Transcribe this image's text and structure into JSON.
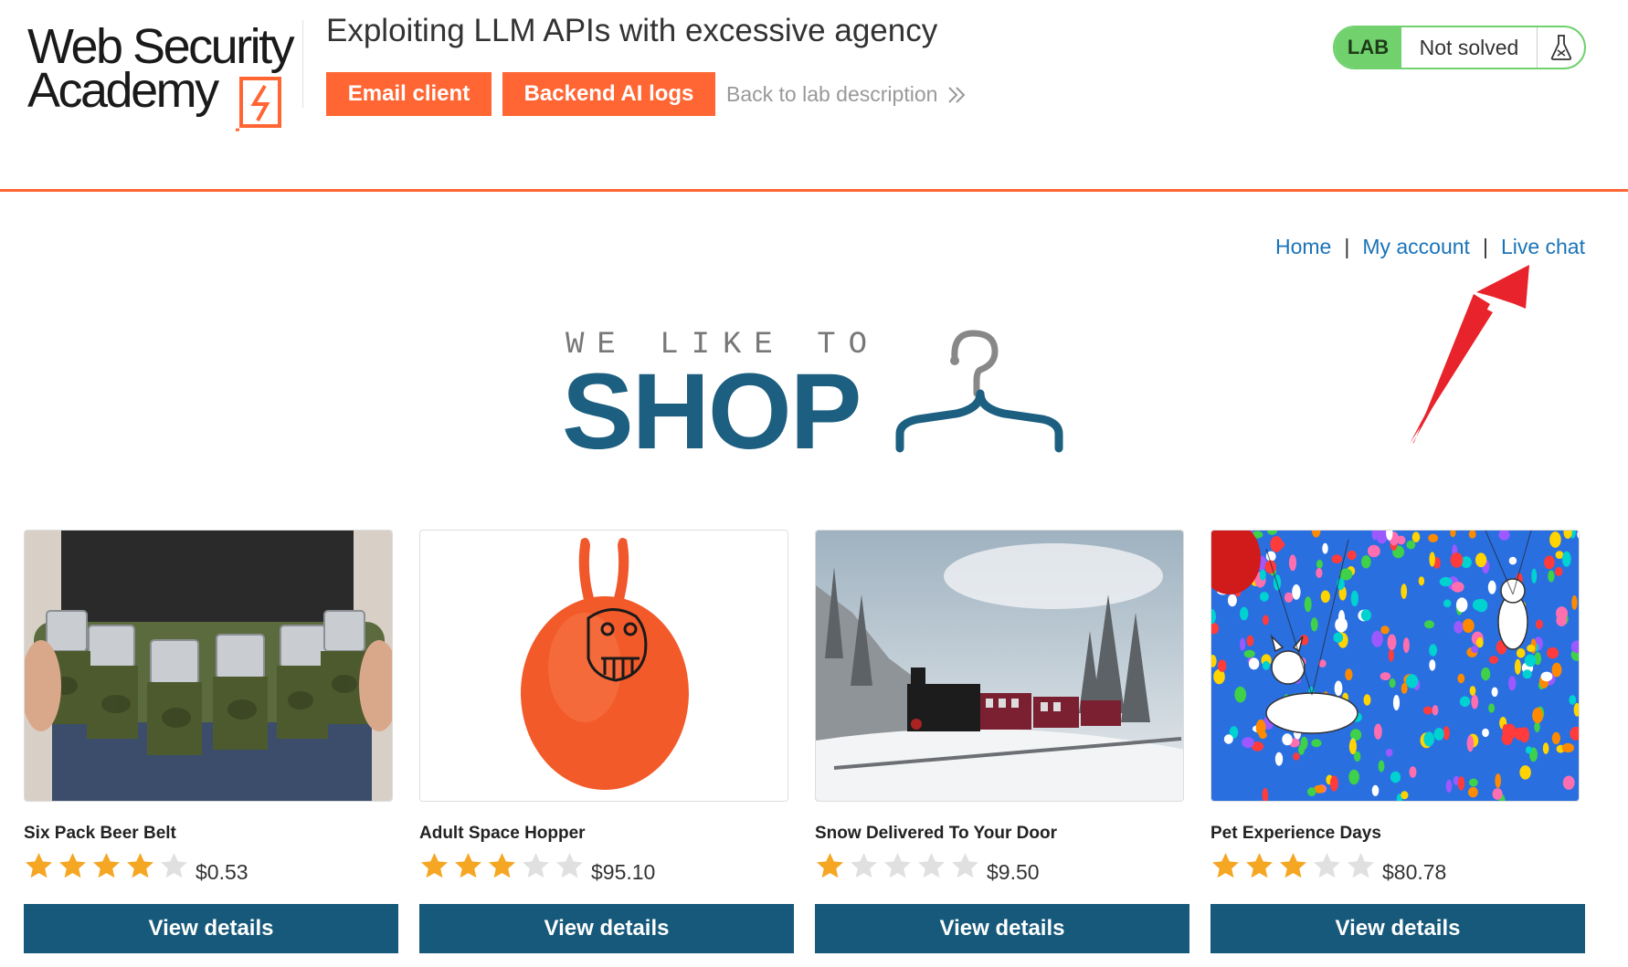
{
  "academy": {
    "logo_line1": "Web Security",
    "logo_line2": "Academy",
    "lab_title": "Exploiting LLM APIs with excessive agency",
    "buttons": {
      "email_client": "Email client",
      "backend_logs": "Backend AI logs"
    },
    "back_link": "Back to lab description",
    "status": {
      "badge": "LAB",
      "state": "Not solved",
      "icon": "flask-icon"
    },
    "colors": {
      "accent": "#ff6633",
      "lab_green": "#70d16d"
    }
  },
  "nav": {
    "home": "Home",
    "sep1": "|",
    "account": "My account",
    "sep2": "|",
    "chat": "Live chat"
  },
  "banner": {
    "top": "WE LIKE TO",
    "main": "SHOP",
    "icon": "hanger-icon"
  },
  "products": [
    {
      "name": "Six Pack Beer Belt",
      "rating": 4,
      "price": "$0.53",
      "button": "View details"
    },
    {
      "name": "Adult Space Hopper",
      "rating": 3,
      "price": "$95.10",
      "button": "View details"
    },
    {
      "name": "Snow Delivered To Your Door",
      "rating": 1,
      "price": "$9.50",
      "button": "View details"
    },
    {
      "name": "Pet Experience Days",
      "rating": 3,
      "price": "$80.78",
      "button": "View details"
    }
  ],
  "colors": {
    "primary": "#16597a",
    "link": "#1a73b8",
    "star_on": "#f5a623",
    "star_off": "#e0e0e0",
    "arrow": "#e8232b"
  }
}
